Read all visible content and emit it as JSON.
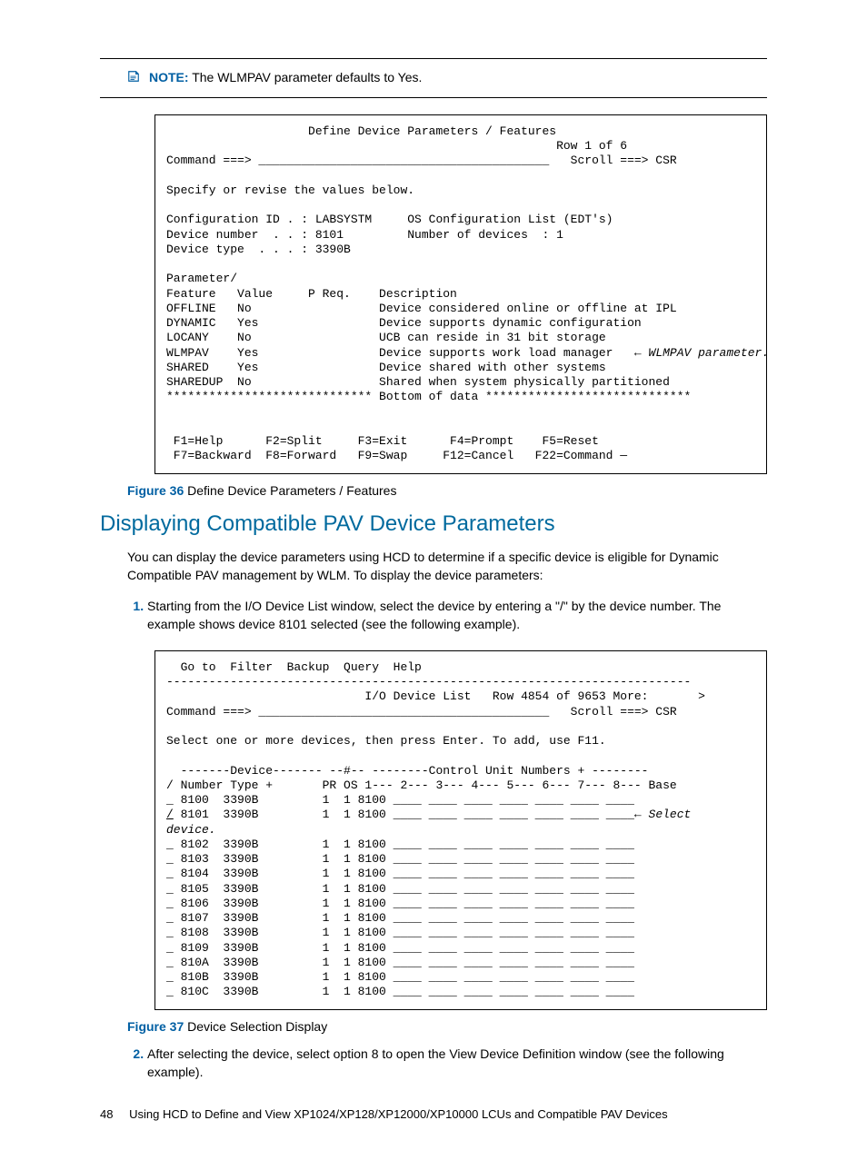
{
  "note": {
    "label": "NOTE:",
    "text": "The WLMPAV parameter defaults to Yes."
  },
  "terminal1": {
    "title": "Define Device Parameters / Features",
    "row_info": "Row 1 of 6",
    "command_label": "Command ===>",
    "command_underline": "_________________________________________",
    "scroll_label": "Scroll ===> CSR",
    "specify": "Specify or revise the values below.",
    "config_id_label": "Configuration ID . : LABSYSTM",
    "os_config": "OS Configuration List (EDT's)",
    "devnum_label": "Device number  . . : 8101",
    "numdev_label": "Number of devices  : 1",
    "devtype_label": "Device type  . . . : 3390B",
    "param_header": "Parameter/",
    "feature_header": "Feature",
    "value_header": "Value",
    "preq_header": "P Req.",
    "desc_header": "Description",
    "rows": [
      {
        "f": "OFFLINE",
        "v": "No",
        "d": "Device considered online or offline at IPL"
      },
      {
        "f": "DYNAMIC",
        "v": "Yes",
        "d": "Device supports dynamic configuration"
      },
      {
        "f": "LOCANY",
        "v": "No",
        "d": "UCB can reside in 31 bit storage"
      },
      {
        "f": "WLMPAV",
        "v": "Yes",
        "d": "Device supports work load manager"
      },
      {
        "f": "SHARED",
        "v": "Yes",
        "d": "Device shared with other systems"
      },
      {
        "f": "SHAREDUP",
        "v": "No",
        "d": "Shared when system physically partitioned"
      }
    ],
    "wlmpav_annot": "WLMPAV parameter.",
    "bottom": "***************************** Bottom of data *****************************",
    "fkeys1": " F1=Help      F2=Split     F3=Exit      F4=Prompt    F5=Reset",
    "fkeys2": " F7=Backward  F8=Forward   F9=Swap     F12=Cancel   F22=Command —"
  },
  "fig36": {
    "label": "Figure 36",
    "text": "Define Device Parameters / Features"
  },
  "section_heading": "Displaying Compatible PAV Device Parameters",
  "intro": "You can display the device parameters using HCD to determine if a specific device is eligible for Dynamic Compatible PAV management by WLM. To display the device parameters:",
  "step1": "Starting from the I/O Device List window, select the device by entering a \"/\" by the device number. The example shows device 8101 selected (see the following example).",
  "terminal2": {
    "menu": "  Go to  Filter  Backup  Query  Help",
    "sep": "--------------------------------------------------------------------------",
    "title": "I/O Device List",
    "row_info": "Row 4854 of 9653 More:       >",
    "command_label": "Command ===>",
    "command_underline": "_________________________________________",
    "scroll_label": "Scroll ===> CSR",
    "select_prompt": "Select one or more devices, then press Enter. To add, use F11.",
    "col_header": "  -------Device------- --#-- --------Control Unit Numbers + --------",
    "col_names": "/ Number Type +       PR OS 1--- 2--- 3--- 4--- 5--- 6--- 7--- 8--- Base",
    "fill": "____ ____ ____ ____ ____ ____ ____",
    "devices": [
      {
        "sel": "_",
        "num": "8100",
        "type": "3390B",
        "pr": "1",
        "os": "1",
        "cu": "8100"
      },
      {
        "sel": "/",
        "num": "8101",
        "type": "3390B",
        "pr": "1",
        "os": "1",
        "cu": "8100"
      },
      {
        "sel": "_",
        "num": "8102",
        "type": "3390B",
        "pr": "1",
        "os": "1",
        "cu": "8100"
      },
      {
        "sel": "_",
        "num": "8103",
        "type": "3390B",
        "pr": "1",
        "os": "1",
        "cu": "8100"
      },
      {
        "sel": "_",
        "num": "8104",
        "type": "3390B",
        "pr": "1",
        "os": "1",
        "cu": "8100"
      },
      {
        "sel": "_",
        "num": "8105",
        "type": "3390B",
        "pr": "1",
        "os": "1",
        "cu": "8100"
      },
      {
        "sel": "_",
        "num": "8106",
        "type": "3390B",
        "pr": "1",
        "os": "1",
        "cu": "8100"
      },
      {
        "sel": "_",
        "num": "8107",
        "type": "3390B",
        "pr": "1",
        "os": "1",
        "cu": "8100"
      },
      {
        "sel": "_",
        "num": "8108",
        "type": "3390B",
        "pr": "1",
        "os": "1",
        "cu": "8100"
      },
      {
        "sel": "_",
        "num": "8109",
        "type": "3390B",
        "pr": "1",
        "os": "1",
        "cu": "8100"
      },
      {
        "sel": "_",
        "num": "810A",
        "type": "3390B",
        "pr": "1",
        "os": "1",
        "cu": "8100"
      },
      {
        "sel": "_",
        "num": "810B",
        "type": "3390B",
        "pr": "1",
        "os": "1",
        "cu": "8100"
      },
      {
        "sel": "_",
        "num": "810C",
        "type": "3390B",
        "pr": "1",
        "os": "1",
        "cu": "8100"
      }
    ],
    "select_annot": "Select",
    "device_annot": "device."
  },
  "fig37": {
    "label": "Figure 37",
    "text": "Device Selection Display"
  },
  "step2": "After selecting the device, select option 8 to open the View Device Definition window (see the following example).",
  "footer": {
    "page": "48",
    "text": "Using HCD to Define and View XP1024/XP128/XP12000/XP10000 LCUs and Compatible PAV Devices"
  }
}
